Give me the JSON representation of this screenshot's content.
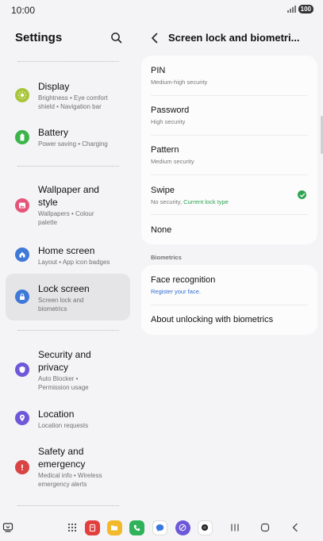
{
  "status_bar": {
    "time": "10:00",
    "battery": "100"
  },
  "left_pane": {
    "title": "Settings",
    "items": [
      {
        "title_lines": [
          "Display"
        ],
        "subtitle_lines": [
          "Brightness • Eye comfort",
          "shield • Navigation bar"
        ],
        "icon": "sun-icon",
        "color": "#a8c53a"
      },
      {
        "title_lines": [
          "Battery"
        ],
        "subtitle_lines": [
          "Power saving • Charging"
        ],
        "icon": "battery-icon",
        "color": "#3bb54a"
      },
      {
        "title_lines": [
          "Wallpaper and",
          "style"
        ],
        "subtitle_lines": [
          "Wallpapers • Colour",
          "palette"
        ],
        "icon": "image-icon",
        "color": "#e5557a"
      },
      {
        "title_lines": [
          "Home screen"
        ],
        "subtitle_lines": [
          "Layout • App icon badges"
        ],
        "icon": "home-icon",
        "color": "#3f79d8"
      },
      {
        "title_lines": [
          "Lock screen"
        ],
        "subtitle_lines": [
          "Screen lock and",
          "biometrics"
        ],
        "icon": "lock-icon",
        "color": "#3f79d8"
      },
      {
        "title_lines": [
          "Security and",
          "privacy"
        ],
        "subtitle_lines": [
          "Auto Blocker •",
          "Permission usage"
        ],
        "icon": "shield-icon",
        "color": "#6e58d9"
      },
      {
        "title_lines": [
          "Location"
        ],
        "subtitle_lines": [
          "Location requests"
        ],
        "icon": "location-pin-icon",
        "color": "#6e58d9"
      },
      {
        "title_lines": [
          "Safety and",
          "emergency"
        ],
        "subtitle_lines": [
          "Medical info • Wireless",
          "emergency alerts"
        ],
        "icon": "alert-icon",
        "color": "#d94343"
      }
    ]
  },
  "right_pane": {
    "title": "Screen lock and biometri...",
    "lock_types": [
      {
        "title": "PIN",
        "subtitle": "Medium-high security"
      },
      {
        "title": "Password",
        "subtitle": "High security"
      },
      {
        "title": "Pattern",
        "subtitle": "Medium security"
      },
      {
        "title": "Swipe",
        "subtitle": "No security,",
        "subtitle_highlight": "Current lock type"
      },
      {
        "title": "None"
      }
    ],
    "biometrics_section": "Biometrics",
    "biometrics": [
      {
        "title": "Face recognition",
        "subtitle": "Register your face."
      },
      {
        "title": "About unlocking with biometrics"
      }
    ]
  }
}
